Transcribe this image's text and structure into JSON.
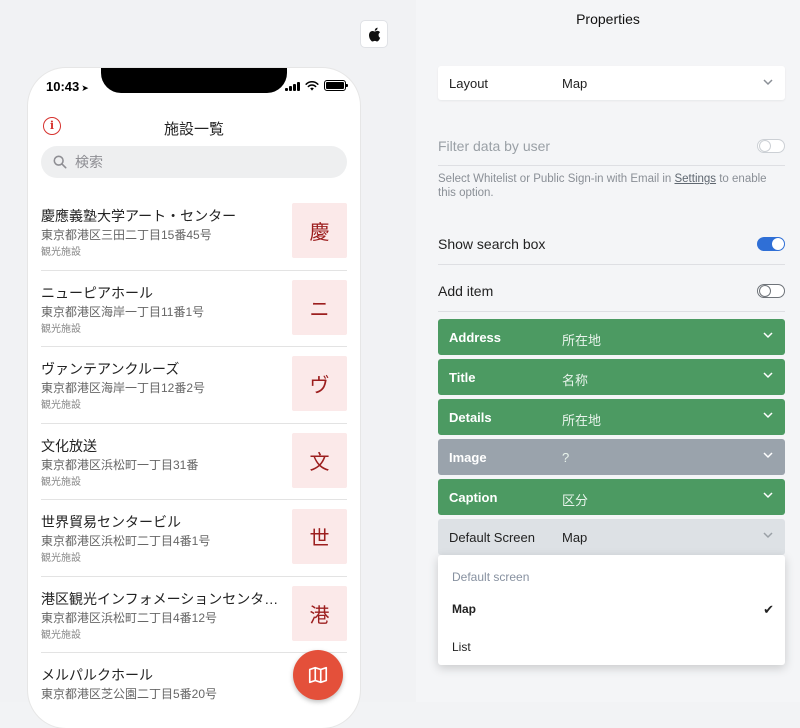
{
  "preview": {
    "os_icon": "apple-icon",
    "status_bar": {
      "time": "10:43"
    },
    "app_title": "施設一覧",
    "search_placeholder": "検索",
    "items": [
      {
        "name": "慶應義塾大学アート・センター",
        "address": "東京都港区三田二丁目15番45号",
        "category": "観光施設",
        "thumb": "慶"
      },
      {
        "name": "ニューピアホール",
        "address": "東京都港区海岸一丁目11番1号",
        "category": "観光施設",
        "thumb": "ニ"
      },
      {
        "name": "ヴァンテアンクルーズ",
        "address": "東京都港区海岸一丁目12番2号",
        "category": "観光施設",
        "thumb": "ヴ"
      },
      {
        "name": "文化放送",
        "address": "東京都港区浜松町一丁目31番",
        "category": "観光施設",
        "thumb": "文"
      },
      {
        "name": "世界貿易センタービル",
        "address": "東京都港区浜松町二丁目4番1号",
        "category": "観光施設",
        "thumb": "世"
      },
      {
        "name": "港区観光インフォメーションセンタ…",
        "address": "東京都港区浜松町二丁目4番12号",
        "category": "観光施設",
        "thumb": "港"
      },
      {
        "name": "メルパルクホール",
        "address": "東京都港区芝公園二丁目5番20号",
        "category": "",
        "thumb": ""
      }
    ]
  },
  "properties": {
    "title": "Properties",
    "layout": {
      "label": "Layout",
      "value": "Map"
    },
    "filter": {
      "label": "Filter data by user",
      "desc_before": "Select Whitelist or Public Sign-in with Email in ",
      "desc_link": "Settings",
      "desc_after": " to enable this option."
    },
    "show_search": {
      "label": "Show search box"
    },
    "add_item": {
      "label": "Add item"
    },
    "fields": [
      {
        "label": "Address",
        "value": "所在地"
      },
      {
        "label": "Title",
        "value": "名称"
      },
      {
        "label": "Details",
        "value": "所在地"
      },
      {
        "label": "Image",
        "value": "?"
      },
      {
        "label": "Caption",
        "value": "区分"
      }
    ],
    "default_screen": {
      "label": "Default Screen",
      "value": "Map",
      "menu_header": "Default screen",
      "options": [
        "Map",
        "List"
      ]
    }
  },
  "colors": {
    "accent_red": "#e4503a",
    "field_green": "#4c9a62",
    "field_gray": "#9aa3ac",
    "toggle_blue": "#2f6fd6"
  }
}
